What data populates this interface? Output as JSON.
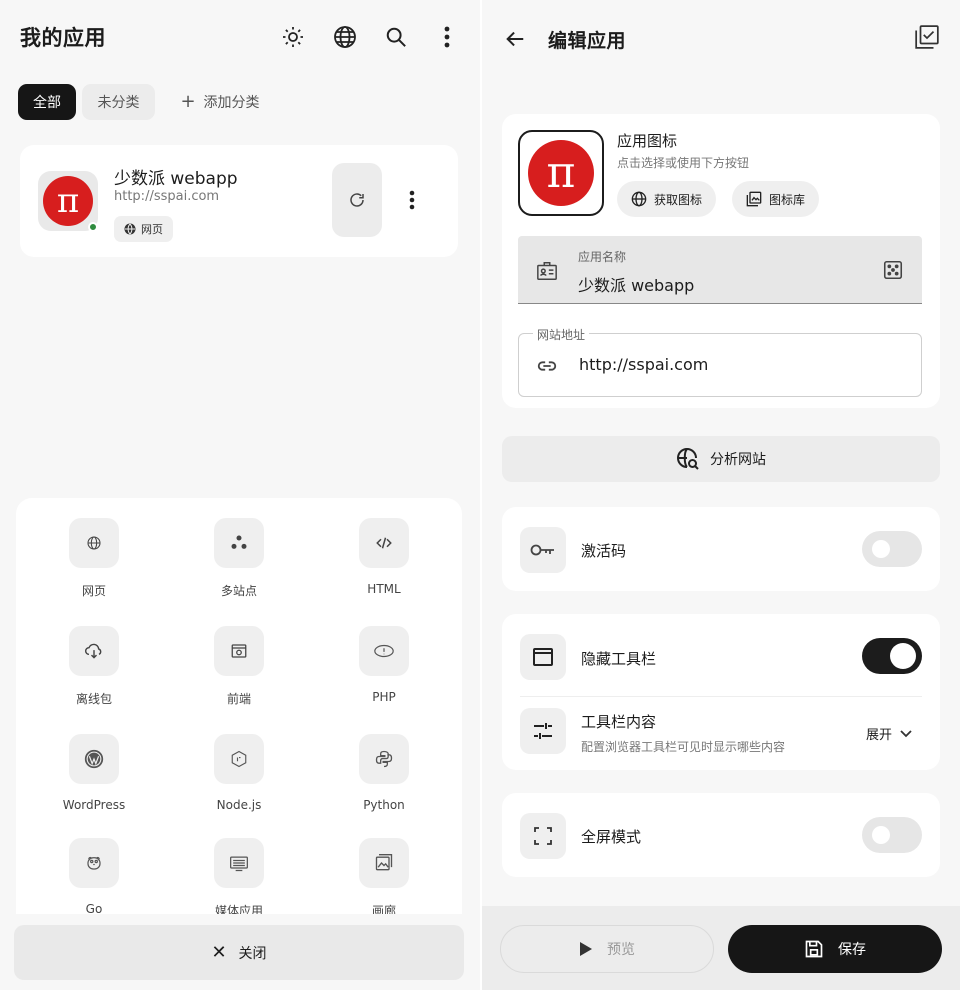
{
  "left": {
    "title": "我的应用",
    "header_icons": [
      "sun-icon",
      "globe-icon",
      "search-icon",
      "more-vertical-icon"
    ],
    "chips": {
      "all": "全部",
      "uncategorized": "未分类",
      "add_category": "添加分类"
    },
    "app": {
      "name": "少数派 webapp",
      "url": "http://sspai.com",
      "tag": "网页",
      "icon_glyph": "π",
      "status_color": "#2e8b3e"
    },
    "types": [
      {
        "label": "网页",
        "icon": "globe-icon"
      },
      {
        "label": "多站点",
        "icon": "multi-site-icon"
      },
      {
        "label": "HTML",
        "icon": "code-icon"
      },
      {
        "label": "离线包",
        "icon": "cloud-download-icon"
      },
      {
        "label": "前端",
        "icon": "frontend-icon"
      },
      {
        "label": "PHP",
        "icon": "php-icon"
      },
      {
        "label": "WordPress",
        "icon": "wordpress-icon"
      },
      {
        "label": "Node.js",
        "icon": "nodejs-icon"
      },
      {
        "label": "Python",
        "icon": "python-icon"
      },
      {
        "label": "Go",
        "icon": "go-icon"
      },
      {
        "label": "媒体应用",
        "icon": "media-icon"
      },
      {
        "label": "画廊",
        "icon": "gallery-icon"
      }
    ],
    "close_label": "关闭"
  },
  "right": {
    "title": "编辑应用",
    "icon_section": {
      "title": "应用图标",
      "subtitle": "点击选择或使用下方按钮",
      "get_icon": "获取图标",
      "icon_library": "图标库"
    },
    "name_field": {
      "label": "应用名称",
      "value": "少数派 webapp"
    },
    "url_field": {
      "label": "网站地址",
      "value": "http://sspai.com"
    },
    "analyze": "分析网站",
    "activation": {
      "label": "激活码",
      "enabled": false
    },
    "hide_toolbar": {
      "label": "隐藏工具栏",
      "enabled": true
    },
    "toolbar_content": {
      "label": "工具栏内容",
      "desc": "配置浏览器工具栏可见时显示哪些内容",
      "action": "展开"
    },
    "fullscreen": {
      "label": "全屏模式",
      "enabled": false
    },
    "preview": "预览",
    "save": "保存"
  },
  "colors": {
    "accent_dark": "#161616",
    "brand_red": "#d71e1e",
    "background": "#f7f7f7"
  }
}
